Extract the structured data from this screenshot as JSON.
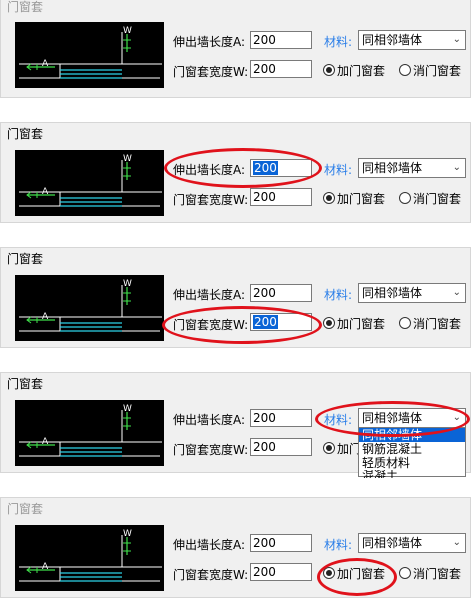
{
  "dialog": {
    "title": "门窗套",
    "length_label": "伸出墙长度A:",
    "width_label": "门窗套宽度W:",
    "length_value": "200",
    "width_value": "200",
    "material_label": "材料:",
    "material_value": "同相邻墙体",
    "radio_add": "加门窗套",
    "radio_remove": "消门窗套",
    "selected_radio": "add",
    "material_options": [
      "同相邻墙体",
      "钢筋混凝土",
      "轻质材料",
      "混凝土"
    ],
    "preview_labels": {
      "w": "W",
      "a": "A"
    }
  },
  "colors": {
    "highlight": "#e0121b",
    "accent": "#2a7ee8",
    "selection": "#0a64d6"
  }
}
